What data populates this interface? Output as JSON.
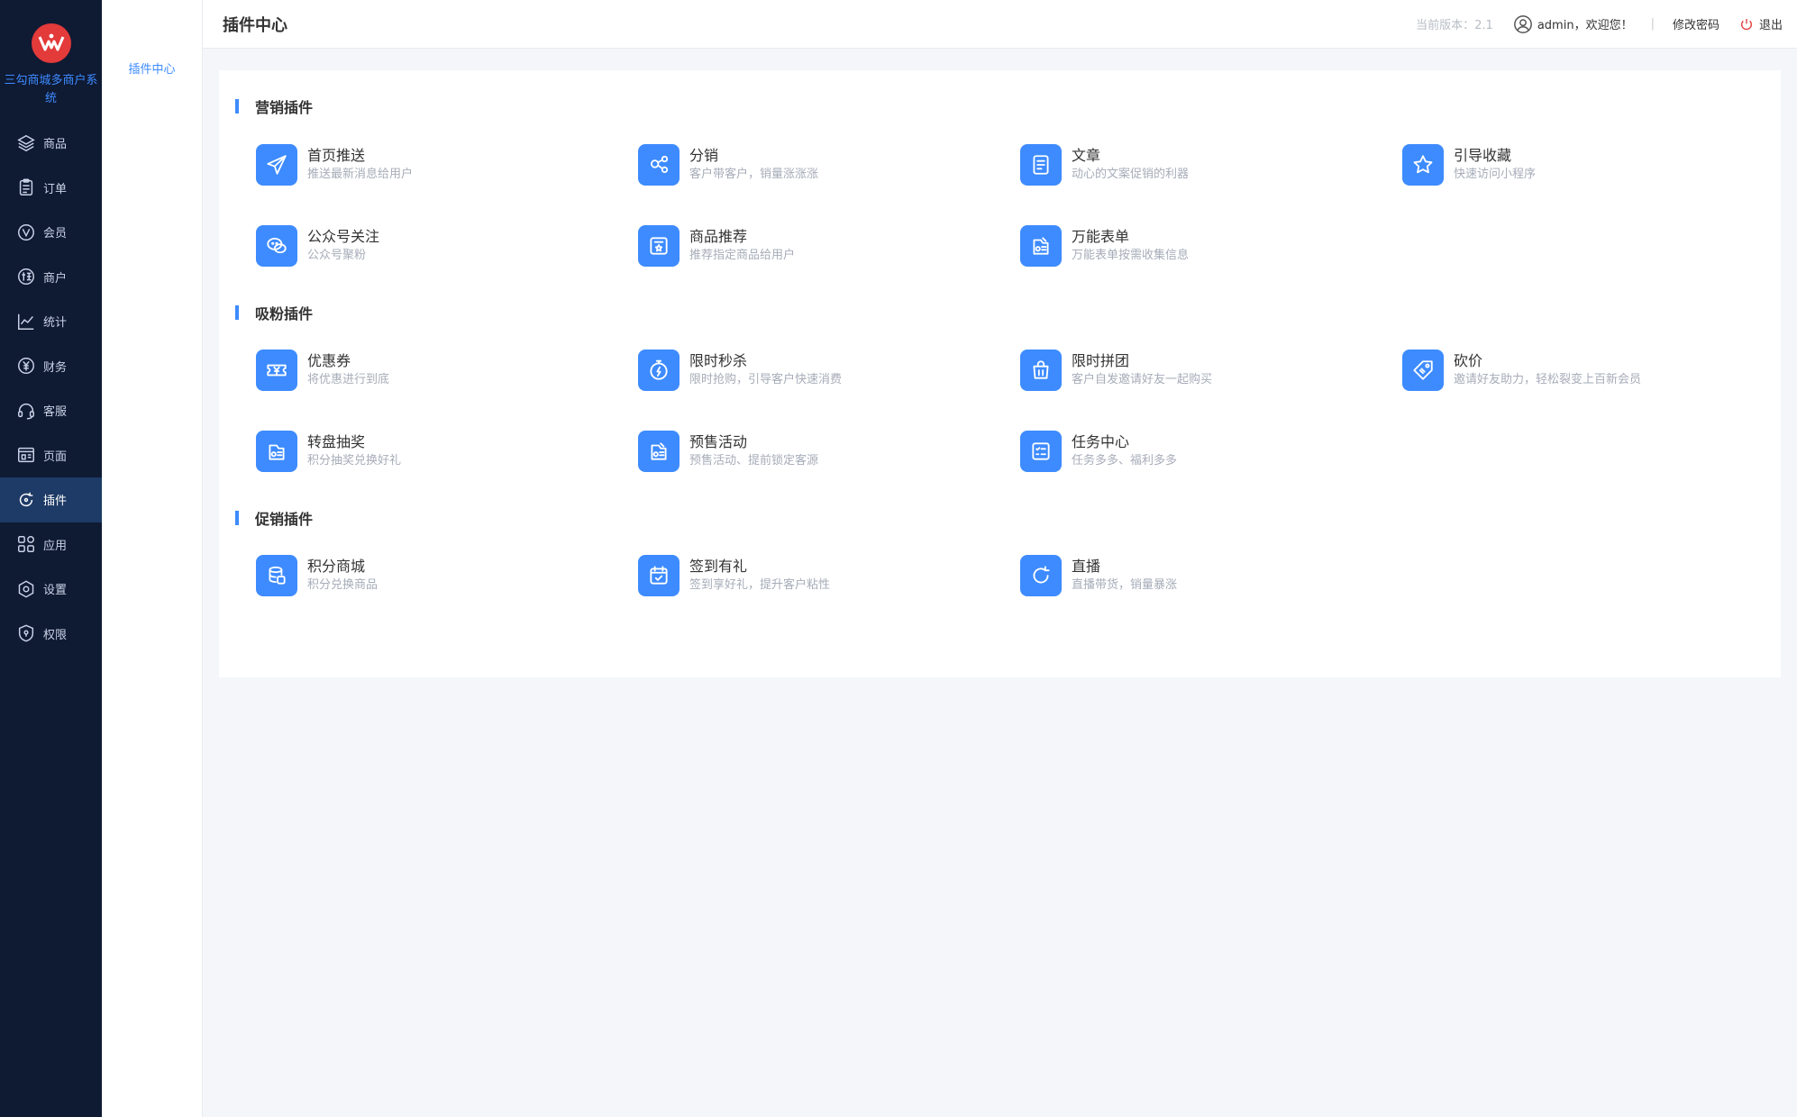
{
  "brand": {
    "name": "三勾商城多商户系统"
  },
  "sidebar": {
    "items": [
      {
        "label": "商品",
        "icon": "layers-icon"
      },
      {
        "label": "订单",
        "icon": "clipboard-icon"
      },
      {
        "label": "会员",
        "icon": "member-v-icon"
      },
      {
        "label": "商户",
        "icon": "supplier-icon"
      },
      {
        "label": "统计",
        "icon": "chart-icon"
      },
      {
        "label": "财务",
        "icon": "finance-icon"
      },
      {
        "label": "客服",
        "icon": "headset-icon"
      },
      {
        "label": "页面",
        "icon": "page-icon"
      },
      {
        "label": "插件",
        "icon": "plugin-icon",
        "active": true
      },
      {
        "label": "应用",
        "icon": "apps-icon"
      },
      {
        "label": "设置",
        "icon": "gear-icon"
      },
      {
        "label": "权限",
        "icon": "shield-icon"
      }
    ]
  },
  "submenu": {
    "current": "插件中心"
  },
  "header": {
    "title": "插件中心",
    "version": "当前版本：2.1",
    "user": "admin，欢迎您！",
    "separator": "|",
    "change_password": "修改密码",
    "logout": "退出"
  },
  "sections": [
    {
      "title": "营销插件",
      "plugins": [
        {
          "name": "首页推送",
          "desc": "推送最新消息给用户",
          "icon": "send-icon"
        },
        {
          "name": "分销",
          "desc": "客户带客户，销量涨涨涨",
          "icon": "share-icon"
        },
        {
          "name": "文章",
          "desc": "动心的文案促销的利器",
          "icon": "article-icon"
        },
        {
          "name": "引导收藏",
          "desc": "快速访问小程序",
          "icon": "star-icon"
        },
        {
          "name": "公众号关注",
          "desc": "公众号聚粉",
          "icon": "wechat-icon"
        },
        {
          "name": "商品推荐",
          "desc": "推荐指定商品给用户",
          "icon": "recommend-icon"
        },
        {
          "name": "万能表单",
          "desc": "万能表单按需收集信息",
          "icon": "form-icon"
        }
      ]
    },
    {
      "title": "吸粉插件",
      "plugins": [
        {
          "name": "优惠券",
          "desc": "将优惠进行到底",
          "icon": "coupon-icon"
        },
        {
          "name": "限时秒杀",
          "desc": "限时抢购，引导客户快速消费",
          "icon": "flash-sale-icon"
        },
        {
          "name": "限时拼团",
          "desc": "客户自发邀请好友一起购买",
          "icon": "group-buy-icon"
        },
        {
          "name": "砍价",
          "desc": "邀请好友助力，轻松裂变上百新会员",
          "icon": "tag-icon"
        },
        {
          "name": "转盘抽奖",
          "desc": "积分抽奖兑换好礼",
          "icon": "lottery-icon"
        },
        {
          "name": "预售活动",
          "desc": "预售活动、提前锁定客源",
          "icon": "presale-icon"
        },
        {
          "name": "任务中心",
          "desc": "任务多多、福利多多",
          "icon": "task-icon"
        }
      ]
    },
    {
      "title": "促销插件",
      "plugins": [
        {
          "name": "积分商城",
          "desc": "积分兑换商品",
          "icon": "points-icon"
        },
        {
          "name": "签到有礼",
          "desc": "签到享好礼，提升客户粘性",
          "icon": "calendar-check-icon"
        },
        {
          "name": "直播",
          "desc": "直播带货，销量暴涨",
          "icon": "live-icon"
        }
      ]
    }
  ],
  "colors": {
    "sidebar_bg": "#0f1a33",
    "accent": "#3d8bff",
    "logout": "#e33a3a"
  }
}
